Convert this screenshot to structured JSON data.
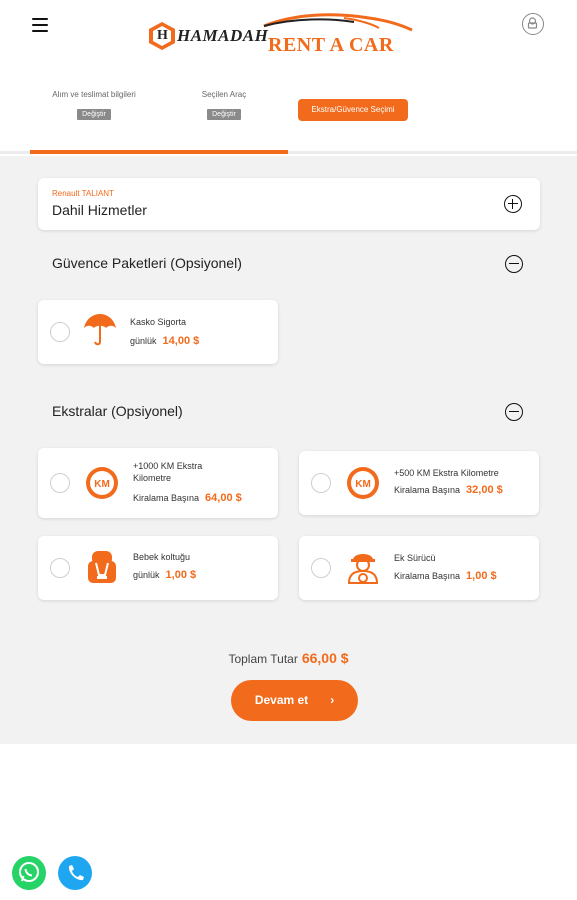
{
  "header": {
    "brand_left": "HAMADAH",
    "brand_right": "RENT A CAR",
    "brand_mark": "H"
  },
  "steps": [
    {
      "label": "Alım ve teslimat bilgileri",
      "change_label": "Değiştir"
    },
    {
      "label": "Seçilen Araç",
      "change_label": "Değiştir"
    },
    {
      "label": "Ekstra/Güvence Seçimi",
      "active": true
    }
  ],
  "included": {
    "car": "Renault TALIANT",
    "title": "Dahil Hizmetler"
  },
  "insurance": {
    "title": "Güvence Paketleri (Opsiyonel)",
    "items": [
      {
        "name": "Kasko Sigorta",
        "unit": "günlük",
        "price": "14,00 $",
        "icon": "umbrella-icon"
      }
    ]
  },
  "extras": {
    "title": "Ekstralar (Opsiyonel)",
    "items": [
      {
        "name": "+1000 KM Ekstra Kilometre",
        "unit": "Kiralama Başına",
        "price": "64,00 $",
        "icon": "km-icon"
      },
      {
        "name": "+500 KM Ekstra Kilometre",
        "unit": "Kiralama Başına",
        "price": "32,00 $",
        "icon": "km-icon"
      },
      {
        "name": "Bebek koltuğu",
        "unit": "günlük",
        "price": "1,00 $",
        "icon": "baby-seat-icon"
      },
      {
        "name": "Ek Sürücü",
        "unit": "Kiralama Başına",
        "price": "1,00 $",
        "icon": "driver-icon"
      }
    ]
  },
  "summary": {
    "total_label": "Toplam Tutar",
    "total_value": "66,00 $",
    "continue_label": "Devam et"
  },
  "colors": {
    "accent": "#f26a1b",
    "whatsapp": "#25d366",
    "phone": "#1ea7f0"
  }
}
